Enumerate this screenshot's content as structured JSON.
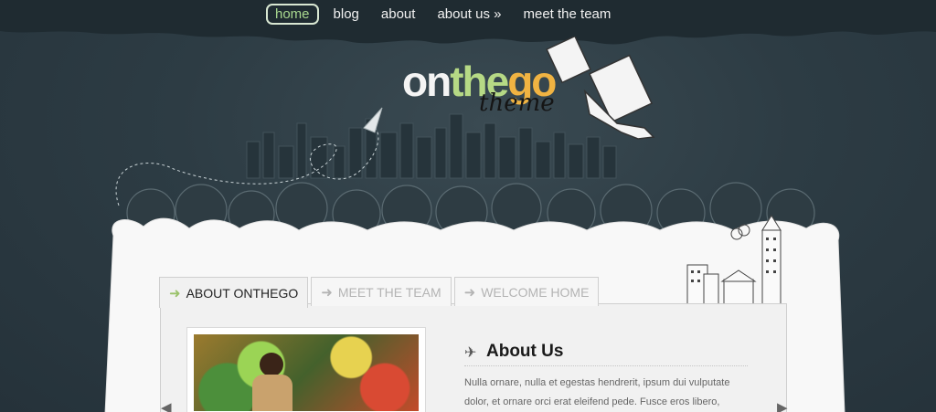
{
  "nav": {
    "items": [
      {
        "label": "home",
        "active": true
      },
      {
        "label": "blog",
        "active": false
      },
      {
        "label": "about",
        "active": false
      },
      {
        "label": "about us »",
        "active": false
      },
      {
        "label": "meet the team",
        "active": false
      }
    ]
  },
  "logo": {
    "part1": "on",
    "part2": "the",
    "part3": "go",
    "sub": "theme"
  },
  "tabs": [
    {
      "label": "ABOUT ONTHEGO",
      "active": true
    },
    {
      "label": "MEET THE TEAM",
      "active": false
    },
    {
      "label": "WELCOME HOME",
      "active": false
    }
  ],
  "about": {
    "title": "About Us",
    "text": "Nulla ornare, nulla et egestas hendrerit, ipsum dui vulputate dolor, et ornare orci erat eleifend pede. Fusce eros libero, vestibulum non,"
  },
  "icons": {
    "tab_arrow": "arrow-right-icon",
    "about_icon": "airplane-icon",
    "prev": "chevron-left-icon",
    "next": "chevron-right-icon"
  },
  "colors": {
    "background": "#2b3a42",
    "accent_green": "#b6d985",
    "accent_orange": "#f0b342"
  }
}
